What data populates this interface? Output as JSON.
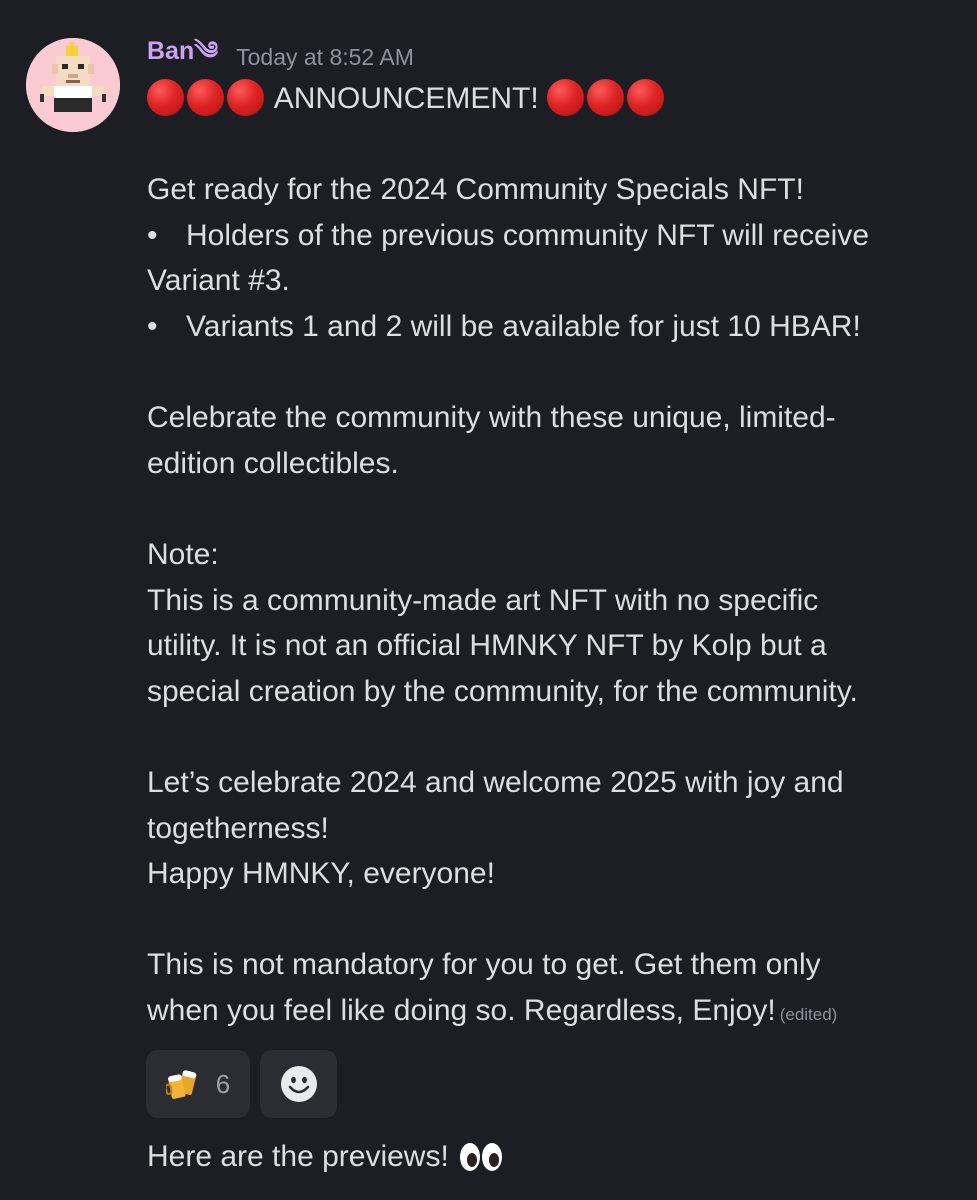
{
  "message": {
    "author": "Ban",
    "author_suffix": "༄",
    "timestamp": "Today at 8:52 AM",
    "lines": {
      "announcement": "ANNOUNCEMENT!",
      "l1": "Get ready for the 2024 Community Specials NFT!",
      "b1_bullet": "•",
      "b1a": "Holders of the previous community NFT will receive",
      "b1b": "Variant #3.",
      "b2_bullet": "•",
      "b2": "Variants 1 and 2 will be available for just 10 HBAR!",
      "l2a": "Celebrate the community with these unique, limited-",
      "l2b": "edition collectibles.",
      "l3": "Note:",
      "l4a": "This is a community-made art NFT with no specific",
      "l4b": "utility. It is not an official HMNKY NFT by Kolp but a",
      "l4c": "special creation by the community, for the community.",
      "l5a": "Let’s celebrate 2024 and welcome 2025 with joy and",
      "l5b": "togetherness!",
      "l6": "Happy HMNKY, everyone!",
      "l7a": "This is not mandatory for you to get. Get them only",
      "l7b": "when you feel like doing so. Regardless, Enjoy!",
      "edited": "(edited)"
    },
    "reactions": [
      {
        "icon": "beer-mugs-icon",
        "count": "6"
      },
      {
        "icon": "add-reaction-icon"
      }
    ]
  },
  "next_message": {
    "text": "Here are the previews!",
    "emoji": "eyes-icon"
  },
  "colors": {
    "background": "#1d1e23",
    "text": "#dcdee1",
    "username": "#c8a4f2",
    "muted": "#8f929a",
    "reaction_bg": "#2b2d33",
    "avatar_bg": "#fbcbd3"
  }
}
